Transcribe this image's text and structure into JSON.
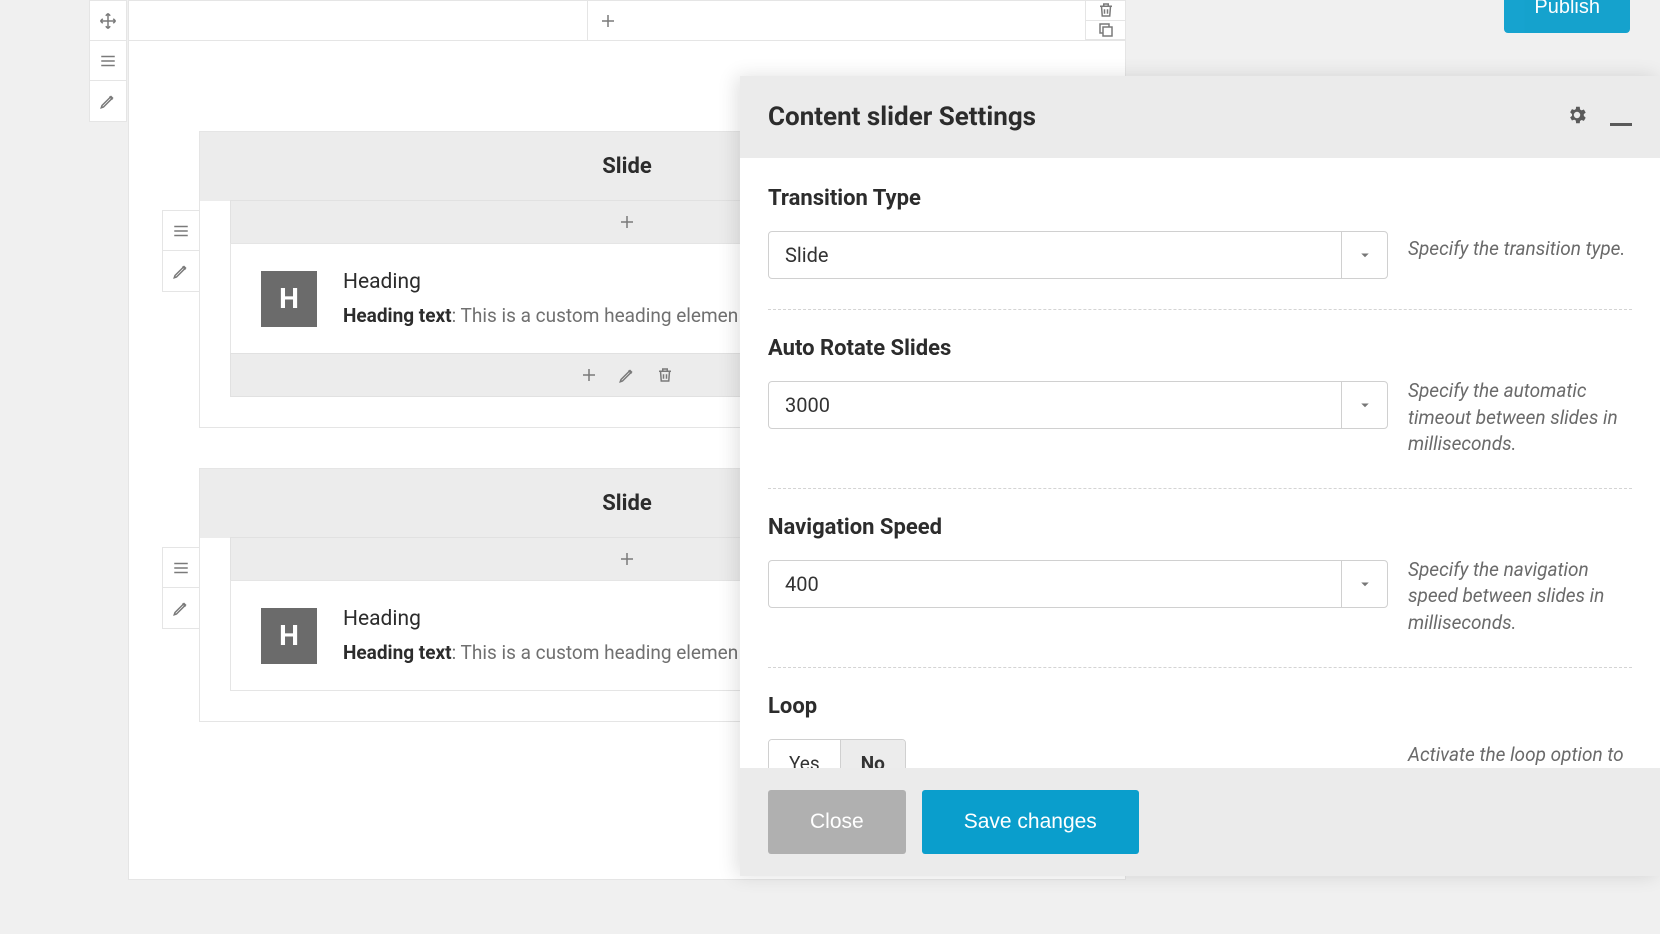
{
  "publish_label": "Publish",
  "slides": [
    {
      "title": "Slide",
      "heading_label": "Heading",
      "heading_text_label": "Heading text",
      "heading_text_value": ": This is a custom heading elemen",
      "badge": "H"
    },
    {
      "title": "Slide",
      "heading_label": "Heading",
      "heading_text_label": "Heading text",
      "heading_text_value": ": This is a custom heading elemen",
      "badge": "H"
    }
  ],
  "settings": {
    "title": "Content slider Settings",
    "fields": {
      "transition": {
        "label": "Transition Type",
        "value": "Slide",
        "hint": "Specify the transition type."
      },
      "auto_rotate": {
        "label": "Auto Rotate Slides",
        "value": "3000",
        "hint": "Specify the automatic timeout between slides in milliseconds."
      },
      "nav_speed": {
        "label": "Navigation Speed",
        "value": "400",
        "hint": "Specify the navigation speed between slides in milliseconds."
      },
      "loop": {
        "label": "Loop",
        "yes": "Yes",
        "no": "No",
        "active": "No",
        "hint": "Activate the loop option to mak the carousel infinite. NB. Don't activate if the slider contains an Isotope index."
      }
    },
    "close": "Close",
    "save": "Save changes"
  }
}
